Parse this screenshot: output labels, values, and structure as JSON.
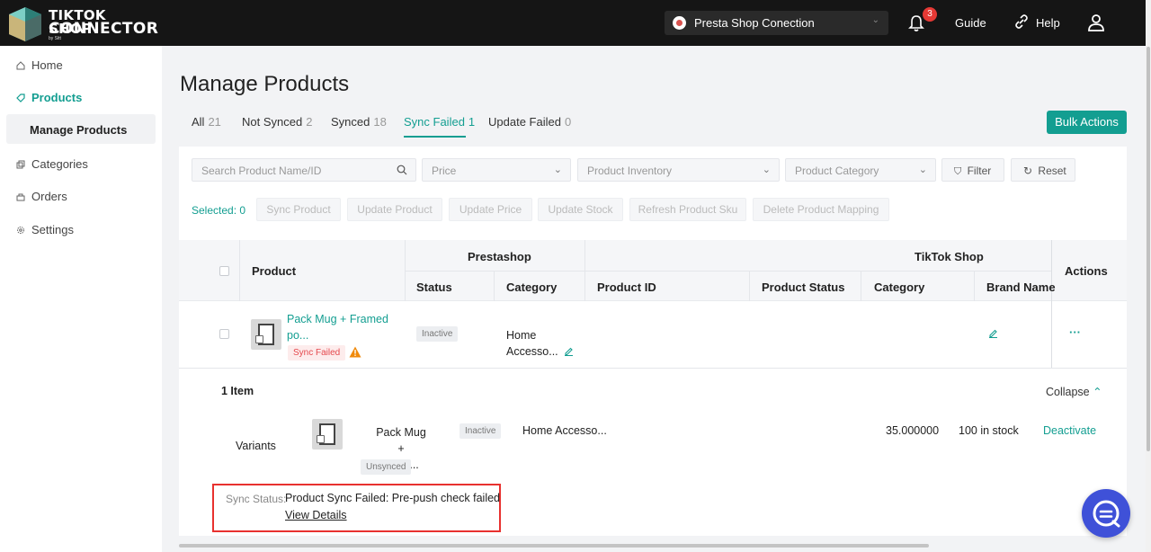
{
  "app": {
    "logo_line1": "TIKTOK SHOP",
    "logo_line2": "CONNECTOR",
    "logo_by": "by Sitt",
    "shop_selector": "Presta Shop Conection",
    "notification_count": "3",
    "guide": "Guide",
    "help": "Help"
  },
  "sidebar": {
    "home": "Home",
    "products": "Products",
    "manage_products": "Manage Products",
    "categories": "Categories",
    "orders": "Orders",
    "settings": "Settings"
  },
  "page": {
    "title": "Manage Products",
    "bulk_actions": "Bulk Actions"
  },
  "tabs": [
    {
      "label": "All",
      "count": "21"
    },
    {
      "label": "Not Synced",
      "count": "2"
    },
    {
      "label": "Synced",
      "count": "18"
    },
    {
      "label": "Sync Failed",
      "count": "1"
    },
    {
      "label": "Update Failed",
      "count": "0"
    }
  ],
  "filters": {
    "search_placeholder": "Search Product Name/ID",
    "price": "Price",
    "inventory": "Product Inventory",
    "category": "Product Category",
    "filter": "Filter",
    "reset": "Reset"
  },
  "actions": {
    "selected": "Selected: 0",
    "sync_product": "Sync Product",
    "update_product": "Update Product",
    "update_price": "Update Price",
    "update_stock": "Update Stock",
    "refresh_sku": "Refresh Product Sku",
    "delete_mapping": "Delete Product Mapping"
  },
  "table": {
    "product": "Product",
    "prestashop": "Prestashop",
    "tiktok_shop": "TikTok Shop",
    "actions": "Actions",
    "status": "Status",
    "category": "Category",
    "product_id": "Product ID",
    "product_status": "Product Status",
    "tt_category": "Category",
    "brand_name": "Brand Name"
  },
  "row": {
    "name_line1": "Pack Mug + Framed",
    "name_line2": "po...",
    "sync_tag": "Sync Failed",
    "status": "Inactive",
    "category_line1": "Home",
    "category_line2": "Accesso...",
    "more": "···"
  },
  "expand": {
    "items": "1 Item",
    "collapse": "Collapse",
    "variants": "Variants",
    "variant_name_line1": "Pack Mug +",
    "variant_name_line2": "Fram...",
    "unsynced": "Unsynced",
    "variant_status": "Inactive",
    "variant_category": "Home Accesso...",
    "price": "35.000000",
    "stock": "100 in stock",
    "deactivate": "Deactivate",
    "sync_status_label": "Sync Status:",
    "sync_status_text": "Product Sync Failed: Pre-push check failed",
    "view_details": "View Details"
  }
}
